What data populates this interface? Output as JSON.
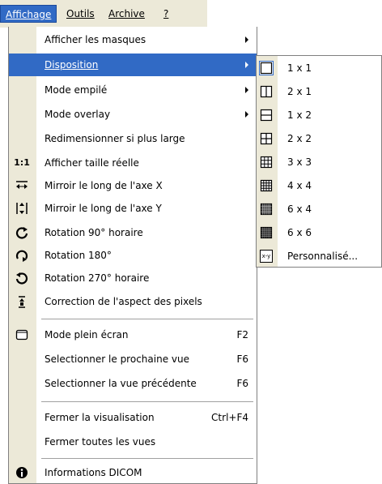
{
  "menubar": {
    "items": [
      "Affichage",
      "Outils",
      "Archive",
      "?"
    ]
  },
  "menu": {
    "items": [
      {
        "label": "Afficher les masques",
        "submenu": true
      },
      {
        "label": "Disposition",
        "submenu": true,
        "highlighted": true
      },
      {
        "label": "Mode empilé",
        "submenu": true
      },
      {
        "label": "Mode overlay",
        "submenu": true
      },
      {
        "label": "Redimensionner si plus large"
      },
      {
        "label": "Afficher taille réelle",
        "icon": "actual-size-icon",
        "icon_text": "1:1"
      },
      {
        "label": "Mirroir le long de l'axe X",
        "icon": "flip-horizontal-icon"
      },
      {
        "label": "Mirroir le long de l'axe Y",
        "icon": "flip-vertical-icon"
      },
      {
        "label": "Rotation 90° horaire",
        "icon": "rotate-90-icon"
      },
      {
        "label": "Rotation 180°",
        "icon": "rotate-180-icon"
      },
      {
        "label": "Rotation 270° horaire",
        "icon": "rotate-270-icon"
      },
      {
        "label": "Correction de l'aspect des pixels",
        "icon": "pixel-aspect-icon"
      },
      {
        "label": "Mode plein écran",
        "shortcut": "F2",
        "icon": "fullscreen-icon"
      },
      {
        "label": "Selectionner le prochaine vue",
        "shortcut": "F6"
      },
      {
        "label": "Selectionner la vue précédente",
        "shortcut": "F6"
      },
      {
        "label": "Fermer la visualisation",
        "shortcut": "Ctrl+F4"
      },
      {
        "label": "Fermer toutes les vues"
      },
      {
        "label": "Informations DICOM",
        "icon": "info-icon"
      }
    ]
  },
  "submenu": {
    "items": [
      {
        "label": "1 x 1",
        "icon": "layout-1x1-icon",
        "selected": true
      },
      {
        "label": "2 x 1",
        "icon": "layout-2x1-icon"
      },
      {
        "label": "1 x 2",
        "icon": "layout-1x2-icon"
      },
      {
        "label": "2 x 2",
        "icon": "layout-2x2-icon"
      },
      {
        "label": "3 x 3",
        "icon": "layout-3x3-icon"
      },
      {
        "label": "4 x 4",
        "icon": "layout-4x4-icon"
      },
      {
        "label": "6 x 4",
        "icon": "layout-6x4-icon"
      },
      {
        "label": "6 x 6",
        "icon": "layout-6x6-icon"
      },
      {
        "label": "Personnalisé...",
        "icon": "layout-custom-icon",
        "icon_text": "x-y"
      }
    ]
  },
  "colors": {
    "highlight": "#316ac5",
    "gutter": "#ece9d8"
  }
}
